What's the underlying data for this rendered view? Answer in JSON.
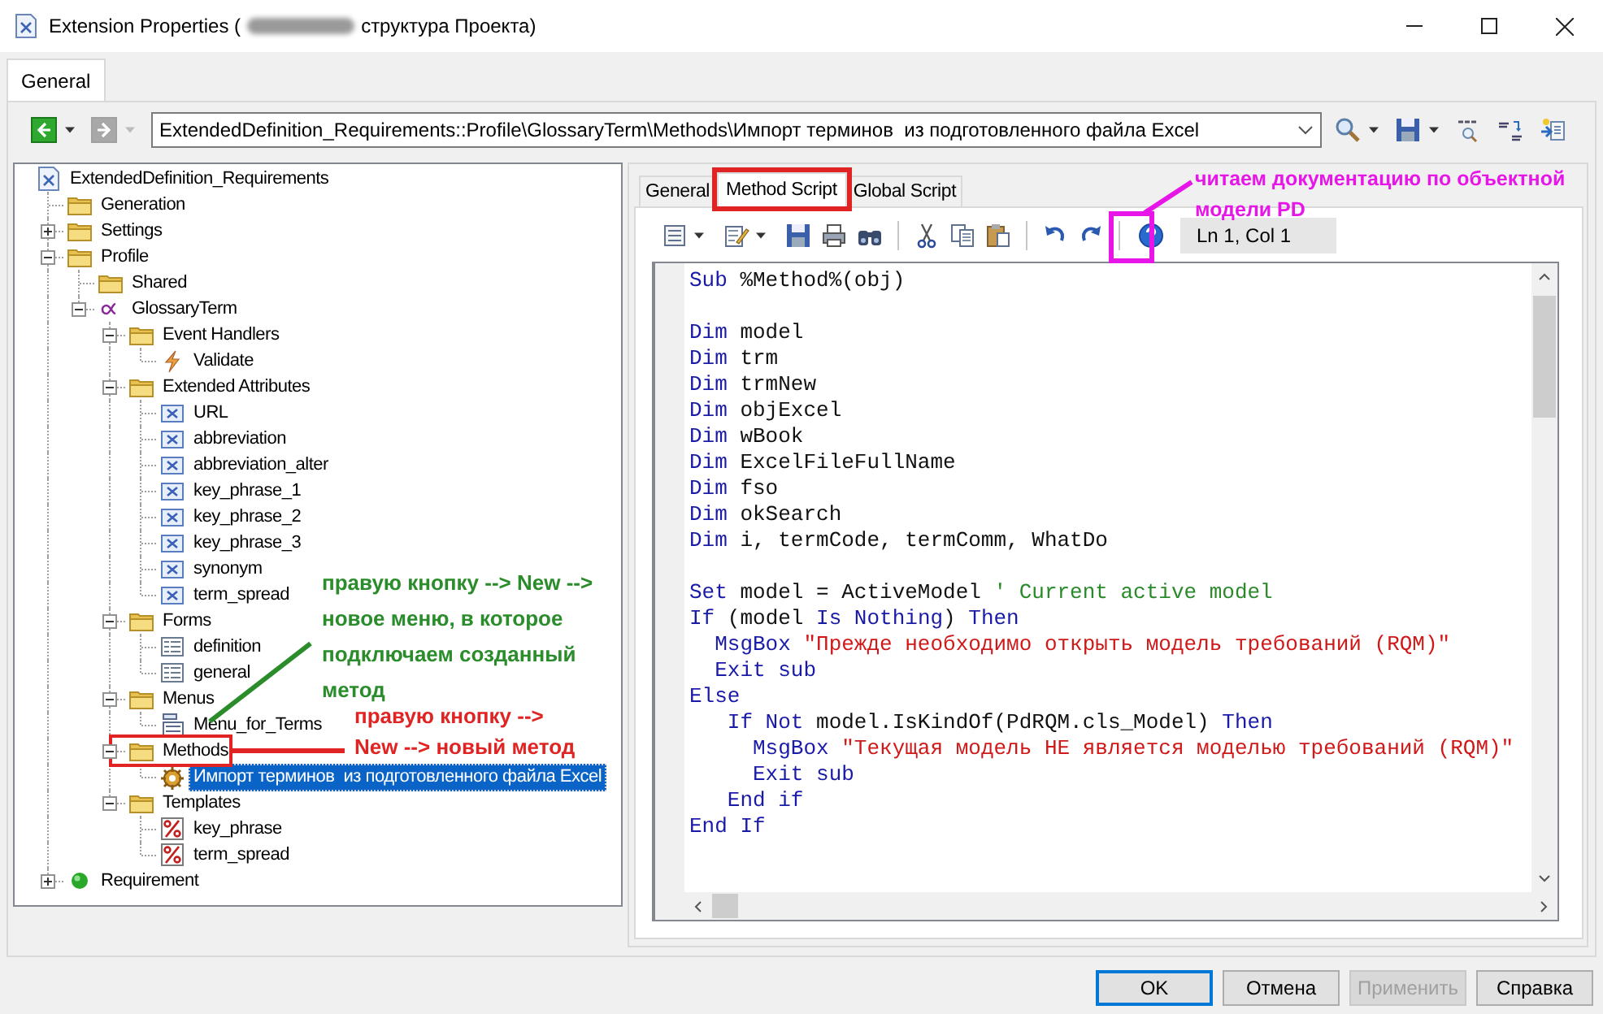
{
  "window": {
    "title": {
      "before_redaction": "Extension Properties (",
      "after_redaction": "структура Проекта)"
    }
  },
  "tabs": [
    {
      "label": "General",
      "selected": true
    }
  ],
  "navigator": {
    "back": {
      "disabled": false
    },
    "forward": {
      "disabled": true
    },
    "path": "ExtendedDefinition_Requirements::Profile\\GlossaryTerm\\Methods\\Импорт терминов  из подготовленного файла Excel"
  },
  "tree": {
    "items": [
      {
        "label": "ExtendedDefinition_Requirements",
        "kind": "model",
        "selected": false,
        "children": [
          {
            "label": "Generation",
            "kind": "folder",
            "selected": false
          },
          {
            "label": "Settings",
            "kind": "folder",
            "selected": false,
            "expanded": false
          },
          {
            "label": "Profile",
            "kind": "folder",
            "selected": false,
            "expanded": true,
            "children": [
              {
                "label": "Shared",
                "kind": "folder",
                "selected": false
              },
              {
                "label": "GlossaryTerm",
                "kind": "stereotype",
                "selected": false,
                "expanded": true,
                "children": [
                  {
                    "label": "Event Handlers",
                    "kind": "folder",
                    "selected": false,
                    "expanded": true,
                    "children": [
                      {
                        "label": "Validate",
                        "kind": "event",
                        "selected": false
                      }
                    ]
                  },
                  {
                    "label": "Extended Attributes",
                    "kind": "folder",
                    "selected": false,
                    "expanded": true,
                    "children": [
                      {
                        "label": "URL",
                        "kind": "attribute",
                        "selected": false
                      },
                      {
                        "label": "abbreviation",
                        "kind": "attribute",
                        "selected": false
                      },
                      {
                        "label": "abbreviation_alter",
                        "kind": "attribute",
                        "selected": false
                      },
                      {
                        "label": "key_phrase_1",
                        "kind": "attribute",
                        "selected": false
                      },
                      {
                        "label": "key_phrase_2",
                        "kind": "attribute",
                        "selected": false
                      },
                      {
                        "label": "key_phrase_3",
                        "kind": "attribute",
                        "selected": false
                      },
                      {
                        "label": "synonym",
                        "kind": "attribute",
                        "selected": false
                      },
                      {
                        "label": "term_spread",
                        "kind": "attribute",
                        "selected": false
                      }
                    ]
                  },
                  {
                    "label": "Forms",
                    "kind": "folder",
                    "selected": false,
                    "expanded": true,
                    "children": [
                      {
                        "label": "definition",
                        "kind": "form",
                        "selected": false
                      },
                      {
                        "label": "general",
                        "kind": "form",
                        "selected": false
                      }
                    ]
                  },
                  {
                    "label": "Menus",
                    "kind": "folder",
                    "selected": false,
                    "expanded": true,
                    "children": [
                      {
                        "label": "Menu_for_Terms",
                        "kind": "menu",
                        "selected": false
                      }
                    ]
                  },
                  {
                    "label": "Methods",
                    "kind": "folder",
                    "selected": false,
                    "expanded": true,
                    "children": [
                      {
                        "label": "Импорт терминов  из подготовленного файла Excel",
                        "kind": "method",
                        "selected": true
                      }
                    ]
                  },
                  {
                    "label": "Templates",
                    "kind": "folder",
                    "selected": false,
                    "expanded": true,
                    "children": [
                      {
                        "label": "key_phrase",
                        "kind": "template",
                        "selected": false
                      },
                      {
                        "label": "term_spread",
                        "kind": "template",
                        "selected": false
                      }
                    ]
                  }
                ]
              }
            ]
          },
          {
            "label": "Requirement",
            "kind": "metaclass",
            "selected": false,
            "expanded": false
          }
        ]
      }
    ]
  },
  "editor": {
    "tabs": [
      {
        "label": "General",
        "selected": false
      },
      {
        "label": "Method Script",
        "selected": true
      },
      {
        "label": "Global Script",
        "selected": false
      }
    ],
    "position": "Ln 1, Col 1",
    "lines": [
      {
        "kind": "code",
        "segments": [
          {
            "kind": "keyword",
            "text": "Sub"
          },
          {
            "kind": "text",
            "text": " %Method%(obj)"
          }
        ]
      },
      {
        "kind": "blank"
      },
      {
        "kind": "code",
        "segments": [
          {
            "kind": "keyword",
            "text": "Dim"
          },
          {
            "kind": "text",
            "text": " model"
          }
        ]
      },
      {
        "kind": "code",
        "segments": [
          {
            "kind": "keyword",
            "text": "Dim"
          },
          {
            "kind": "text",
            "text": " trm"
          }
        ]
      },
      {
        "kind": "code",
        "segments": [
          {
            "kind": "keyword",
            "text": "Dim"
          },
          {
            "kind": "text",
            "text": " trmNew"
          }
        ]
      },
      {
        "kind": "code",
        "segments": [
          {
            "kind": "keyword",
            "text": "Dim"
          },
          {
            "kind": "text",
            "text": " objExcel"
          }
        ]
      },
      {
        "kind": "code",
        "segments": [
          {
            "kind": "keyword",
            "text": "Dim"
          },
          {
            "kind": "text",
            "text": " wBook"
          }
        ]
      },
      {
        "kind": "code",
        "segments": [
          {
            "kind": "keyword",
            "text": "Dim"
          },
          {
            "kind": "text",
            "text": " ExcelFileFullName"
          }
        ]
      },
      {
        "kind": "code",
        "segments": [
          {
            "kind": "keyword",
            "text": "Dim"
          },
          {
            "kind": "text",
            "text": " fso"
          }
        ]
      },
      {
        "kind": "code",
        "segments": [
          {
            "kind": "keyword",
            "text": "Dim"
          },
          {
            "kind": "text",
            "text": " okSearch"
          }
        ]
      },
      {
        "kind": "code",
        "segments": [
          {
            "kind": "keyword",
            "text": "Dim"
          },
          {
            "kind": "text",
            "text": " i, termCode, termComm, WhatDo"
          }
        ]
      },
      {
        "kind": "blank"
      },
      {
        "kind": "code",
        "segments": [
          {
            "kind": "keyword",
            "text": "Set"
          },
          {
            "kind": "text",
            "text": " model = ActiveModel "
          },
          {
            "kind": "comment",
            "text": "' Current active model"
          }
        ]
      },
      {
        "kind": "code",
        "segments": [
          {
            "kind": "keyword",
            "text": "If"
          },
          {
            "kind": "text",
            "text": " (model "
          },
          {
            "kind": "keyword",
            "text": "Is Nothing"
          },
          {
            "kind": "text",
            "text": ") "
          },
          {
            "kind": "keyword",
            "text": "Then"
          }
        ]
      },
      {
        "kind": "code",
        "segments": [
          {
            "kind": "keyword",
            "text": "  MsgBox "
          },
          {
            "kind": "string",
            "text": "\"Прежде необходимо открыть модель требований (RQM)\""
          }
        ]
      },
      {
        "kind": "code",
        "segments": [
          {
            "kind": "keyword",
            "text": "  Exit sub"
          }
        ]
      },
      {
        "kind": "code",
        "segments": [
          {
            "kind": "keyword",
            "text": "Else"
          }
        ]
      },
      {
        "kind": "code",
        "segments": [
          {
            "kind": "keyword",
            "text": "   If Not"
          },
          {
            "kind": "text",
            "text": " model.IsKindOf(PdRQM.cls_Model) "
          },
          {
            "kind": "keyword",
            "text": "Then"
          }
        ]
      },
      {
        "kind": "code",
        "segments": [
          {
            "kind": "keyword",
            "text": "     MsgBox "
          },
          {
            "kind": "string",
            "text": "\"Текущая модель НЕ является моделью требований (RQM)\""
          }
        ]
      },
      {
        "kind": "code",
        "segments": [
          {
            "kind": "keyword",
            "text": "     Exit sub"
          }
        ]
      },
      {
        "kind": "code",
        "segments": [
          {
            "kind": "keyword",
            "text": "   End if"
          }
        ]
      },
      {
        "kind": "code",
        "segments": [
          {
            "kind": "keyword",
            "text": "End If"
          }
        ]
      }
    ]
  },
  "annotations": [
    {
      "kind": "help",
      "text": "читаем документацию по объектной\nмодели PD",
      "color": "#e815e8"
    },
    {
      "kind": "menu",
      "text": "правую кнопку --> New -->\nновое меню, в которое\nподключаем созданный\nметод",
      "color": "#2a8c2a"
    },
    {
      "kind": "method",
      "text": "правую кнопку -->\nNew --> новый метод",
      "color": "#e02424"
    },
    {
      "kind": "tab",
      "color": "#e02424"
    }
  ],
  "buttons": [
    {
      "label": "OK",
      "default": true,
      "disabled": false
    },
    {
      "label": "Отмена",
      "default": false,
      "disabled": false
    },
    {
      "label": "Применить",
      "default": false,
      "disabled": true
    },
    {
      "label": "Справка",
      "default": false,
      "disabled": false
    }
  ]
}
